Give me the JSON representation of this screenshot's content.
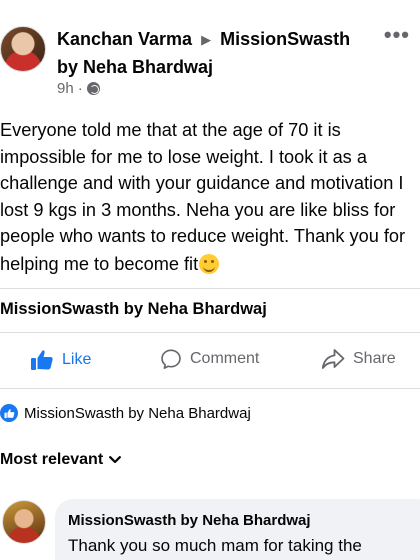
{
  "post": {
    "author_line1": "Kanchan Varma",
    "arrow": "▶",
    "author_line2_a": "MissionSwasth",
    "author_line2_b": "by Neha Bhardwaj",
    "time": "9h",
    "dot": "·",
    "privacy_icon": "globe-icon",
    "more_label": "•••",
    "text": "Everyone told me that at the age of 70 it is impossible for me to lose weight. I took it as a challenge and with your guidance and motivation I lost 9 kgs in 3 months. Neha you are like bliss for people who wants to reduce weight. Thank you for helping me to become fit",
    "emoji": "smiling-face-emoji"
  },
  "page_name": "MissionSwasth by Neha Bhardwaj",
  "actions": {
    "like": "Like",
    "comment": "Comment",
    "share": "Share"
  },
  "reactions": {
    "reacted_by": "MissionSwasth by Neha Bhardwaj"
  },
  "sort": {
    "label": "Most relevant"
  },
  "comment": {
    "author": "MissionSwasth by Neha Bhardwaj",
    "text": "Thank you so much mam for taking the"
  },
  "colors": {
    "accent": "#1877f2",
    "muted": "#65676b",
    "bubble": "#f0f2f5"
  }
}
